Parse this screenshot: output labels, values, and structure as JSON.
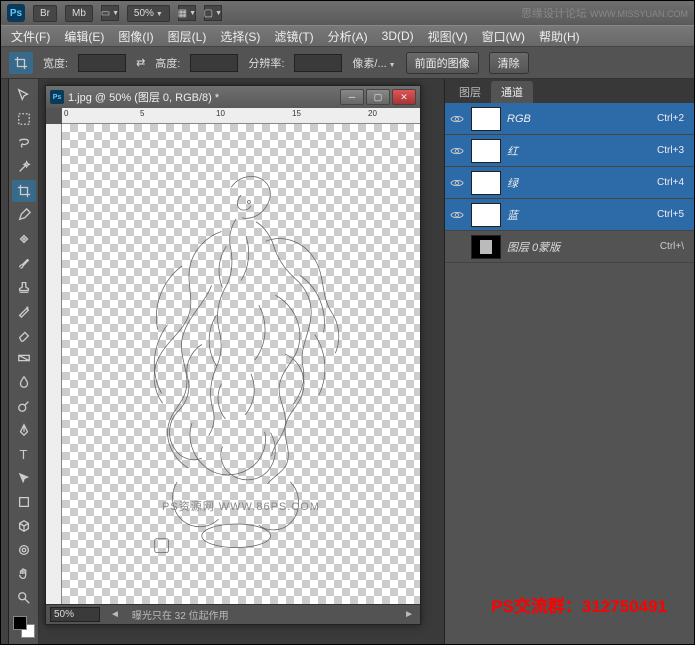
{
  "titlebar": {
    "br": "Br",
    "mb": "Mb",
    "zoom": "50%",
    "brand": "思缘设计论坛",
    "brand_url": "WWW.MISSYUAN.COM"
  },
  "menu": [
    "文件(F)",
    "编辑(E)",
    "图像(I)",
    "图层(L)",
    "选择(S)",
    "滤镜(T)",
    "分析(A)",
    "3D(D)",
    "视图(V)",
    "窗口(W)",
    "帮助(H)"
  ],
  "options": {
    "width_label": "宽度:",
    "height_label": "高度:",
    "res_label": "分辨率:",
    "unit": "像素/...",
    "front_btn": "前面的图像",
    "clear_btn": "清除"
  },
  "doc": {
    "title": "1.jpg @ 50% (图层 0, RGB/8) *",
    "watermark": "PS资源网  WWW.86PS.COM",
    "zoom": "50%",
    "status": "曝光只在 32 位起作用"
  },
  "panel": {
    "tab_layers": "图层",
    "tab_channels": "通道"
  },
  "channels": [
    {
      "name": "RGB",
      "shortcut": "Ctrl+2",
      "sel": true
    },
    {
      "name": "红",
      "shortcut": "Ctrl+3",
      "sel": true
    },
    {
      "name": "绿",
      "shortcut": "Ctrl+4",
      "sel": true
    },
    {
      "name": "蓝",
      "shortcut": "Ctrl+5",
      "sel": true
    },
    {
      "name": "图层 0蒙版",
      "shortcut": "Ctrl+\\",
      "sel": false,
      "mask": true
    }
  ],
  "overlay": "PS交流群：312750491",
  "ruler_marks": [
    "0",
    "5",
    "10",
    "15",
    "20"
  ]
}
